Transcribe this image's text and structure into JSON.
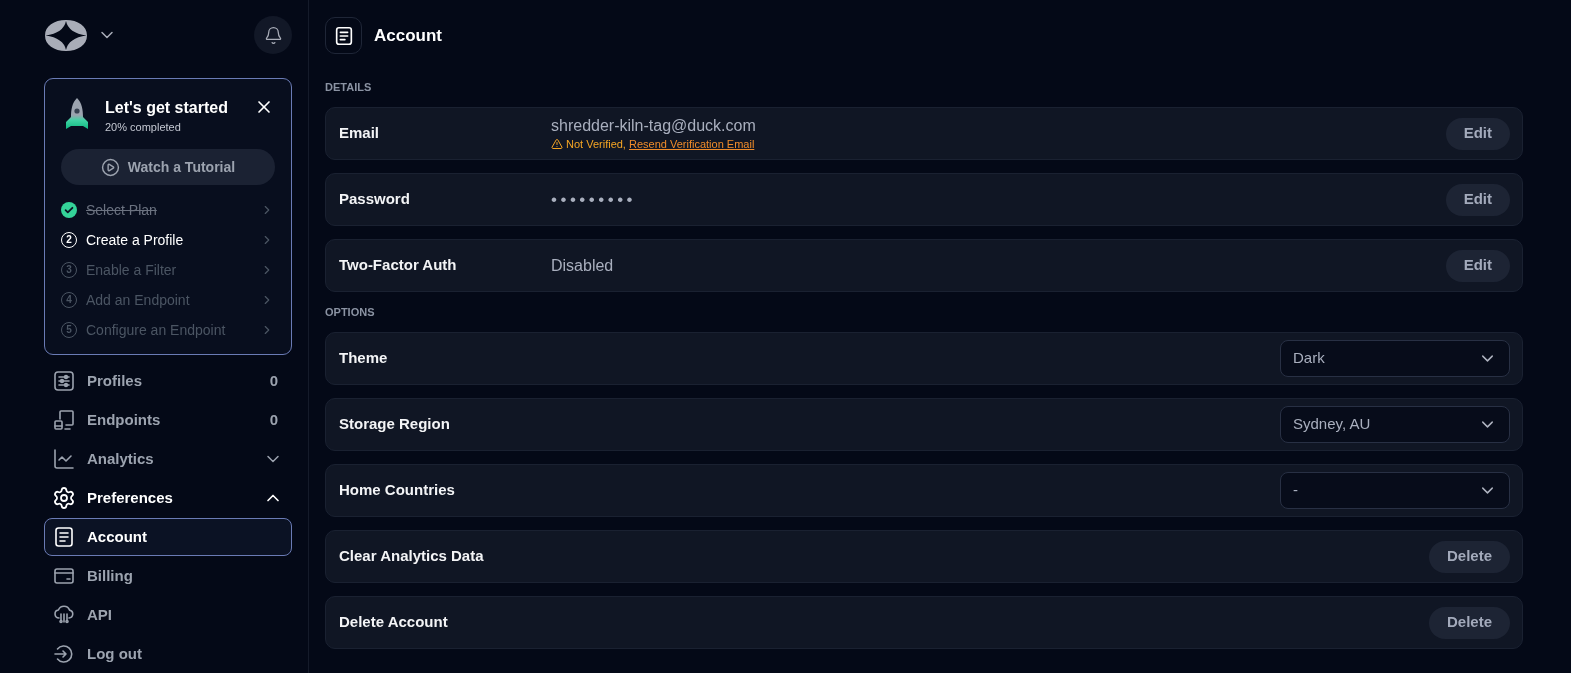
{
  "sidebar": {
    "onboarding": {
      "title": "Let's get started",
      "progress": "20% completed",
      "tutorial_button": "Watch a Tutorial",
      "steps": [
        {
          "kind": "done",
          "label": "Select Plan"
        },
        {
          "kind": "current",
          "number": "2",
          "label": "Create a Profile"
        },
        {
          "kind": "pending",
          "number": "3",
          "label": "Enable a Filter"
        },
        {
          "kind": "pending",
          "number": "4",
          "label": "Add an Endpoint"
        },
        {
          "kind": "pending",
          "number": "5",
          "label": "Configure an Endpoint"
        }
      ]
    },
    "nav": [
      {
        "kind": "count",
        "label": "Profiles",
        "count": "0",
        "selected": false
      },
      {
        "kind": "count",
        "label": "Endpoints",
        "count": "0",
        "selected": false
      },
      {
        "kind": "group",
        "label": "Analytics",
        "expanded": false,
        "selected": false
      },
      {
        "kind": "group",
        "label": "Preferences",
        "expanded": true,
        "selected": false,
        "children": [
          {
            "label": "Account",
            "selected": true
          },
          {
            "label": "Billing",
            "selected": false
          },
          {
            "label": "API",
            "selected": false
          }
        ]
      },
      {
        "kind": "link",
        "label": "Log out",
        "selected": false
      }
    ]
  },
  "main": {
    "title": "Account",
    "sections": [
      {
        "title": "DETAILS",
        "rows": [
          {
            "kind": "text",
            "label": "Email",
            "value": "shredder-kiln-tag@duck.com",
            "warning": "Not Verified,",
            "warning_link": "Resend Verification Email",
            "button": "Edit"
          },
          {
            "kind": "masked",
            "label": "Password",
            "value": "•••••••••",
            "button": "Edit"
          },
          {
            "kind": "text",
            "label": "Two-Factor Auth",
            "value": "Disabled",
            "button": "Edit"
          }
        ]
      },
      {
        "title": "OPTIONS",
        "rows": [
          {
            "kind": "select",
            "label": "Theme",
            "value": "Dark"
          },
          {
            "kind": "select",
            "label": "Storage Region",
            "value": "Sydney, AU"
          },
          {
            "kind": "select",
            "label": "Home Countries",
            "value": "-"
          },
          {
            "kind": "button",
            "label": "Clear Analytics Data",
            "button": "Delete"
          },
          {
            "kind": "button",
            "label": "Delete Account",
            "button": "Delete"
          }
        ]
      }
    ]
  }
}
